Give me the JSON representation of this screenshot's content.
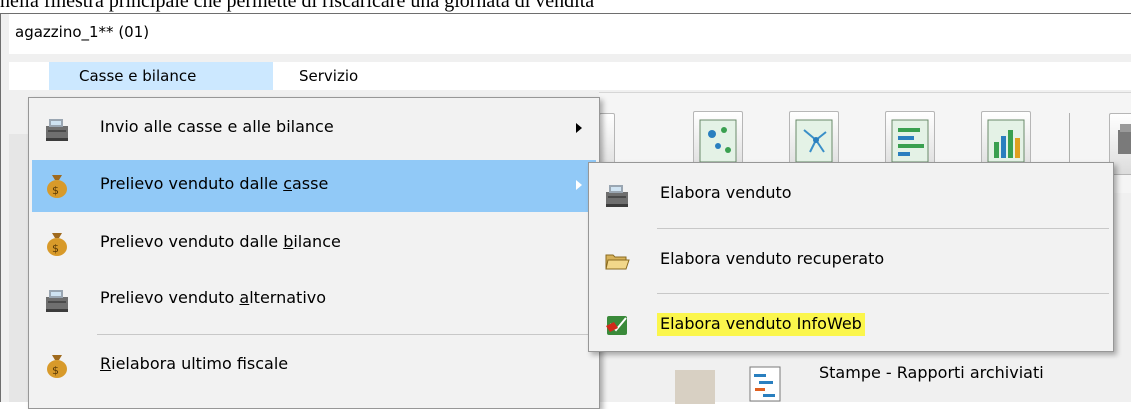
{
  "doc_caption": "nella finestra principale che permette di riscaricare una giornata di vendita",
  "window": {
    "title": "agazzino_1** (01)"
  },
  "menubar": {
    "items": [
      {
        "label": "Casse e bilance"
      },
      {
        "label": "Servizio"
      }
    ]
  },
  "main_menu": {
    "items": [
      {
        "label": "Invio alle casse e alle bilance",
        "icon": "cash-register-icon",
        "has_submenu": true
      },
      {
        "label": "Prelievo venduto dalle casse",
        "icon": "money-bag-icon",
        "has_submenu": true,
        "highlighted": true,
        "mnemonic_pre": "Prelievo venduto dalle ",
        "mnemonic_char": "c",
        "mnemonic_post": "asse"
      },
      {
        "label": "Prelievo venduto dalle bilance",
        "icon": "money-bag-icon",
        "mnemonic_pre": "Prelievo venduto dalle ",
        "mnemonic_char": "b",
        "mnemonic_post": "ilance"
      },
      {
        "label": "Prelievo venduto alternativo",
        "icon": "cash-register-icon",
        "mnemonic_pre": "Prelievo venduto ",
        "mnemonic_char": "a",
        "mnemonic_post": "lternativo"
      },
      {
        "label": "Rielabora ultimo fiscale",
        "icon": "money-bag-icon",
        "mnemonic_char": "R",
        "mnemonic_post": "ielabora ultimo fiscale"
      }
    ]
  },
  "submenu": {
    "items": [
      {
        "label": "Elabora venduto",
        "icon": "cash-register-icon"
      },
      {
        "label": "Elabora venduto recuperato",
        "icon": "folder-open-icon"
      },
      {
        "label": "Elabora venduto InfoWeb",
        "icon": "web-download-icon",
        "highlight_color": "#fbf64c"
      }
    ]
  },
  "background": {
    "archive_label": "Stampe - Rapporti archiviati"
  },
  "colors": {
    "menu_hover": "#91c9f7",
    "menubar_active": "#cce8ff",
    "annotation_highlight": "#fbf64c"
  }
}
